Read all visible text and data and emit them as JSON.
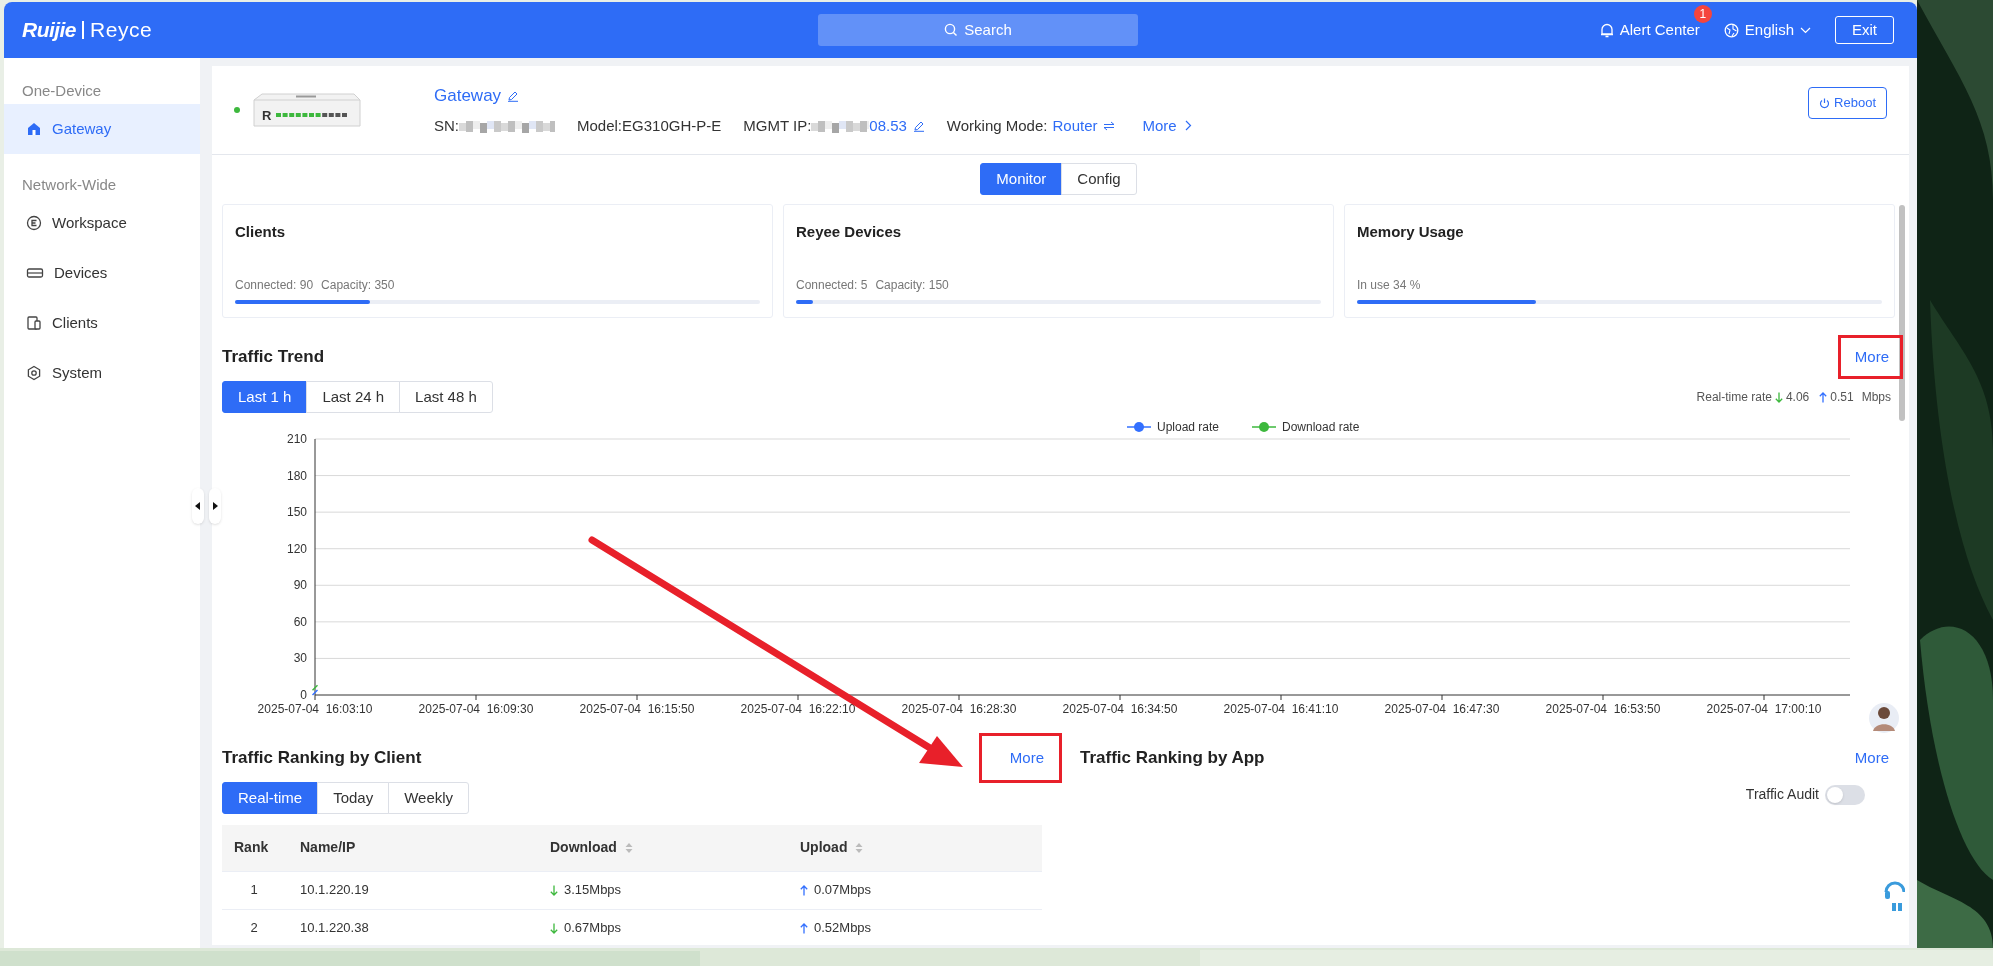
{
  "brand": {
    "name": "Ruijie",
    "product": "Reyce"
  },
  "header": {
    "search": "Search",
    "alert": {
      "label": "Alert Center",
      "count": "1"
    },
    "language": "English",
    "exit": "Exit"
  },
  "sidebar": {
    "sections": [
      {
        "title": "One-Device",
        "items": [
          {
            "label": "Gateway",
            "kind": "home",
            "selected": true
          }
        ]
      },
      {
        "title": "Network-Wide",
        "items": [
          {
            "label": "Workspace",
            "kind": "workspace",
            "selected": false
          },
          {
            "label": "Devices",
            "kind": "devices",
            "selected": false
          },
          {
            "label": "Clients",
            "kind": "clients",
            "selected": false
          },
          {
            "label": "System",
            "kind": "system",
            "selected": false
          }
        ]
      }
    ]
  },
  "device": {
    "online": true,
    "badge": "R",
    "name": "Gateway",
    "sn_label": "SN:",
    "model": "Model:EG310GH-P-E",
    "ip_label": "MGMT IP:",
    "ip_tail": "08.53",
    "mode_label": "Working Mode:",
    "mode": "Router",
    "more": "More",
    "reboot": "Reboot"
  },
  "view_tabs": [
    {
      "label": "Monitor",
      "selected": true
    },
    {
      "label": "Config",
      "selected": false
    }
  ],
  "cards": [
    {
      "title": "Clients",
      "stats": [
        "Connected: 90",
        "Capacity: 350"
      ],
      "level": 0.257
    },
    {
      "title": "Reyee Devices",
      "stats": [
        "Connected: 5",
        "Capacity: 150"
      ],
      "level": 0.033
    },
    {
      "title": "Memory Usage",
      "stats": [
        "In use 34 %"
      ],
      "level": 0.34
    }
  ],
  "traffic_trend": {
    "title": "Traffic Trend",
    "more": {
      "label": "More",
      "highlighted": true
    },
    "ranges": [
      {
        "label": "Last 1 h",
        "selected": true
      },
      {
        "label": "Last 24 h",
        "selected": false
      },
      {
        "label": "Last 48 h",
        "selected": false
      }
    ],
    "realtime": {
      "label": "Real-time rate",
      "down": "4.06",
      "up": "0.51",
      "unit": "Mbps"
    },
    "chart_data": {
      "type": "line",
      "grid": true,
      "legend": "top",
      "x": [
        "2025-07-04  16:03:10",
        "2025-07-04  16:09:30",
        "2025-07-04  16:15:50",
        "2025-07-04  16:22:10",
        "2025-07-04  16:28:30",
        "2025-07-04  16:34:50",
        "2025-07-04  16:41:10",
        "2025-07-04  16:47:30",
        "2025-07-04  16:53:50",
        "2025-07-04  17:00:10"
      ],
      "series": [
        {
          "name": "Upload rate",
          "color": "#3370ff",
          "marker": "cross",
          "values": [
            2,
            null,
            null,
            null,
            null,
            null,
            null,
            null,
            null,
            null
          ]
        },
        {
          "name": "Download rate",
          "color": "#3db83d",
          "marker": "cross",
          "values": [
            6,
            null,
            null,
            null,
            null,
            null,
            null,
            null,
            null,
            null
          ]
        }
      ],
      "ylim": [
        0,
        210
      ],
      "yticks": [
        0,
        30,
        60,
        90,
        120,
        150,
        180,
        210
      ]
    }
  },
  "ranking_client": {
    "title": "Traffic Ranking by Client",
    "more": {
      "label": "More",
      "highlighted": true
    },
    "ranges": [
      {
        "label": "Real-time",
        "selected": true
      },
      {
        "label": "Today",
        "selected": false
      },
      {
        "label": "Weekly",
        "selected": false
      }
    ],
    "columns": [
      {
        "label": "Rank",
        "sortable": false
      },
      {
        "label": "Name/IP",
        "sortable": false
      },
      {
        "label": "Download",
        "sortable": true
      },
      {
        "label": "Upload",
        "sortable": true
      }
    ],
    "rows": [
      {
        "rank": "1",
        "name": "10.1.220.19",
        "download": "3.15Mbps",
        "upload": "0.07Mbps"
      },
      {
        "rank": "2",
        "name": "10.1.220.38",
        "download": "0.67Mbps",
        "upload": "0.52Mbps"
      }
    ]
  },
  "ranking_app": {
    "title": "Traffic Ranking by App",
    "more": {
      "label": "More",
      "highlighted": false
    },
    "audit": {
      "label": "Traffic Audit",
      "on": false
    }
  }
}
